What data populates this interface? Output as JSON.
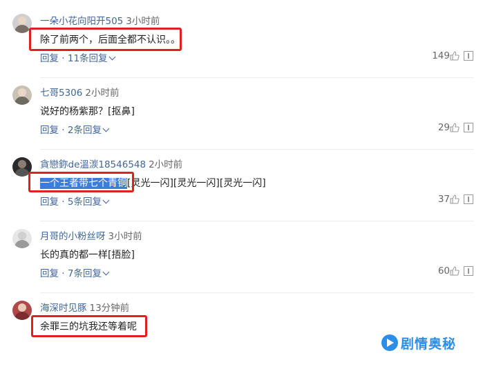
{
  "comments": [
    {
      "user": "一朵小花向阳开505",
      "time": "3小时前",
      "text": "除了前两个，后面全都不认识。。",
      "reply": "回复 · 11条回复",
      "likes": "149"
    },
    {
      "user": "七哥5306",
      "time": "2小时前",
      "text": "说好的杨紫那？[抠鼻]",
      "reply": "回复 · 2条回复",
      "likes": "29"
    },
    {
      "user": "貪戀鉨de溫湠18546548",
      "time": "2小时前",
      "text_selected": "一个王者带七个青铜",
      "text_rest": "[灵光一闪][灵光一闪][灵光一闪]",
      "reply": "回复 · 5条回复",
      "likes": "37"
    },
    {
      "user": "月哥的小粉丝呀",
      "time": "3小时前",
      "text": "长的真的都一样[捂脸]",
      "reply": "回复 · 7条回复",
      "likes": "60"
    },
    {
      "user": "海深时见豚",
      "time": "13分钟前",
      "text": "余罪三的坑我还等着呢"
    }
  ],
  "watermark": "剧情奥秘",
  "colors": {
    "username": "#406599",
    "highlight_box": "#e02020",
    "selection": "#3b7ed9",
    "watermark": "#2d8ee8"
  },
  "icons": [
    "thumbs-up-icon",
    "report-icon",
    "chevron-down-icon"
  ]
}
